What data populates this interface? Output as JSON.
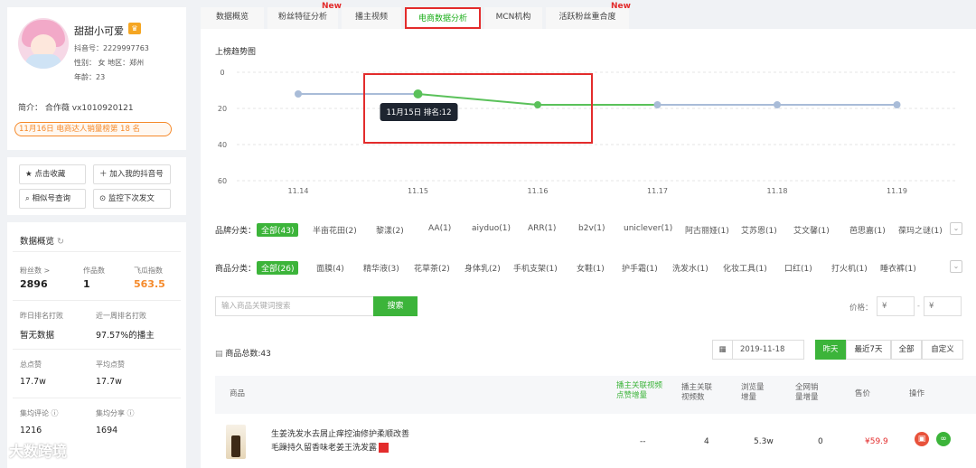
{
  "profile": {
    "name": "甜甜小可爱",
    "badge_icon": "crown-icon",
    "douyin_id": "抖音号：2229997763",
    "gender_region": "性别： 女   地区：郑州",
    "age": "年龄：23",
    "intro": "简介： 合作薇 vx1010920121",
    "rank_text": "11月16日 电商达人销量榜第 18 名"
  },
  "side_buttons": {
    "collect": "★ 点击收藏",
    "add": "＋ 加入我的抖音号",
    "similar": "相似号查询",
    "monitor": "监控下次发文"
  },
  "overview": {
    "title": "数据概览",
    "fans_label": "粉丝数 >",
    "fans_value": "2896",
    "works_label": "作品数",
    "works_value": "1",
    "index_label": "飞瓜指数",
    "index_value": "563.5",
    "yesterday_label": "昨日排名打败",
    "yesterday_value": "暂无数据",
    "week_label": "近一周排名打败",
    "week_value": "97.57%的播主",
    "likes_label": "总点赞",
    "likes_value": "17.7w",
    "avg_likes_label": "平均点赞",
    "avg_likes_value": "17.7w",
    "comments_label": "集均评论 ⓘ",
    "comments_value": "1216",
    "shares_label": "集均分享 ⓘ",
    "shares_value": "1694"
  },
  "tabs": [
    {
      "label": "数据概览"
    },
    {
      "label": "粉丝特征分析",
      "new": "New"
    },
    {
      "label": "播主视频"
    },
    {
      "label": "电商数据分析"
    },
    {
      "label": "MCN机构"
    },
    {
      "label": "活跃粉丝重合度",
      "new": "New"
    }
  ],
  "chart_data": {
    "type": "line",
    "title": "上榜趋势图",
    "categories": [
      "11.14",
      "11.15",
      "11.16",
      "11.17",
      "11.18",
      "11.19"
    ],
    "series": [
      {
        "values": [
          12,
          12,
          18,
          18,
          18,
          18
        ]
      }
    ],
    "ylim": [
      0,
      60
    ],
    "yticks": [
      "0",
      "20",
      "40",
      "60"
    ],
    "y_inverted": true,
    "tooltip": "11月15日 排名:12",
    "colors": {
      "gray": "#a9bcd8",
      "green": "#5ac15a"
    }
  },
  "brand_filter": {
    "label": "品牌分类：",
    "items": [
      "全部(43)",
      "半亩花田(2)",
      "黎漾(2)",
      "AA(1)",
      "aiyduo(1)",
      "ARR(1)",
      "b2v(1)",
      "uniclever(1)",
      "阿古丽娅(1)",
      "艾苏恩(1)",
      "艾文馨(1)",
      "芭思嘉(1)",
      "葆玛之谜(1)"
    ]
  },
  "product_filter": {
    "label": "商品分类：",
    "items": [
      "全部(26)",
      "面膜(4)",
      "精华液(3)",
      "花草茶(2)",
      "身体乳(2)",
      "手机支架(1)",
      "女鞋(1)",
      "护手霜(1)",
      "洗发水(1)",
      "化妆工具(1)",
      "口红(1)",
      "打火机(1)",
      "睡衣裤(1)"
    ]
  },
  "search": {
    "placeholder": "输入商品关键词搜索",
    "button": "搜索"
  },
  "price": {
    "label": "价格：",
    "min": "¥",
    "max": "¥"
  },
  "products_total": "商品总数:43",
  "date": "2019-11-18",
  "date_buttons": [
    "昨天",
    "最近7天",
    "全部",
    "自定义"
  ],
  "table": {
    "headers": [
      "商品",
      "播主关联视频点赞增量",
      "播主关联视频数",
      "浏览量增量",
      "全网销量增量",
      "售价",
      "操作"
    ],
    "row": {
      "title_line1": "生姜洗发水去屑止痒控油修护柔顺改善",
      "title_line2": "毛躁持久留香味老姜王洗发露",
      "likes": "--",
      "videos": "4",
      "views": "5.3w",
      "sales": "0",
      "price": "¥59.9"
    }
  },
  "watermark": "大数跨境",
  "colors": {
    "accent": "#3cb43a",
    "highlight": "#e32c2c",
    "orange": "#f58a2b"
  }
}
